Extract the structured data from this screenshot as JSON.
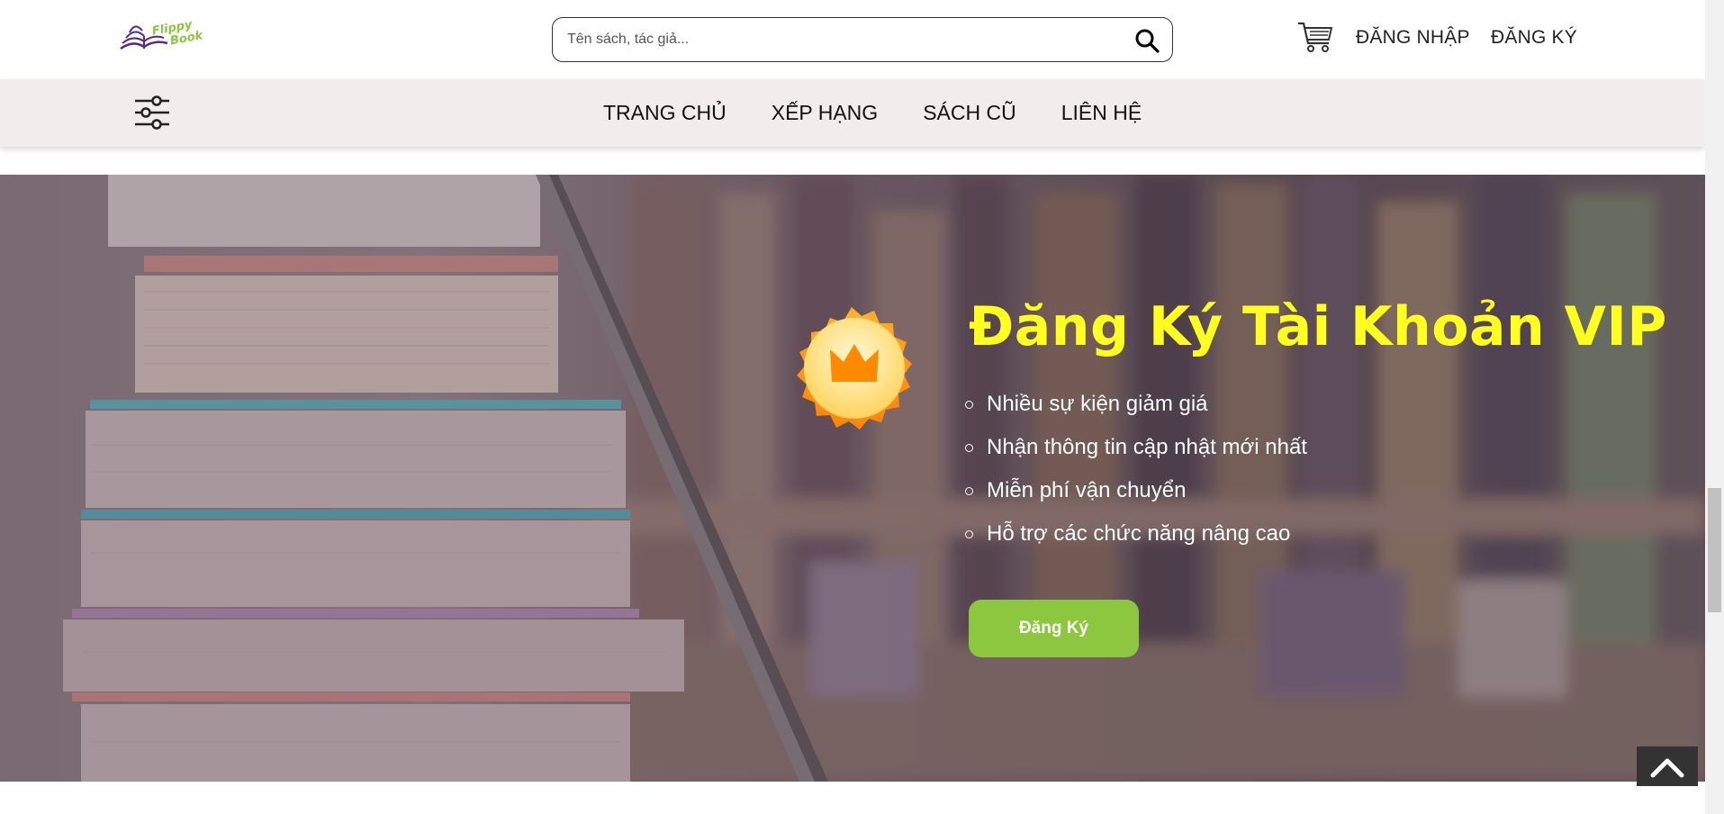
{
  "header": {
    "logo_text": [
      "Flippy",
      "Book"
    ],
    "search": {
      "placeholder": "Tên sách, tác giả..."
    },
    "login_label": "ĐĂNG NHẬP",
    "register_label": "ĐĂNG KÝ"
  },
  "nav": {
    "items": [
      {
        "label": "TRANG CHỦ"
      },
      {
        "label": "XẾP HẠNG"
      },
      {
        "label": "SÁCH CŨ"
      },
      {
        "label": "LIÊN HỆ"
      }
    ]
  },
  "hero": {
    "title": "Đăng Ký Tài Khoản VIP",
    "features": [
      "Nhiều sự kiện giảm giá",
      "Nhận thông tin cập nhật mới nhất",
      "Miễn phí vận chuyển",
      "Hỗ trợ các chức năng nâng cao"
    ],
    "cta_label": "Đăng Ký"
  },
  "colors": {
    "title": "#ffff20",
    "cta": "#8dc63f",
    "navbar_bg": "#f2ecec"
  }
}
